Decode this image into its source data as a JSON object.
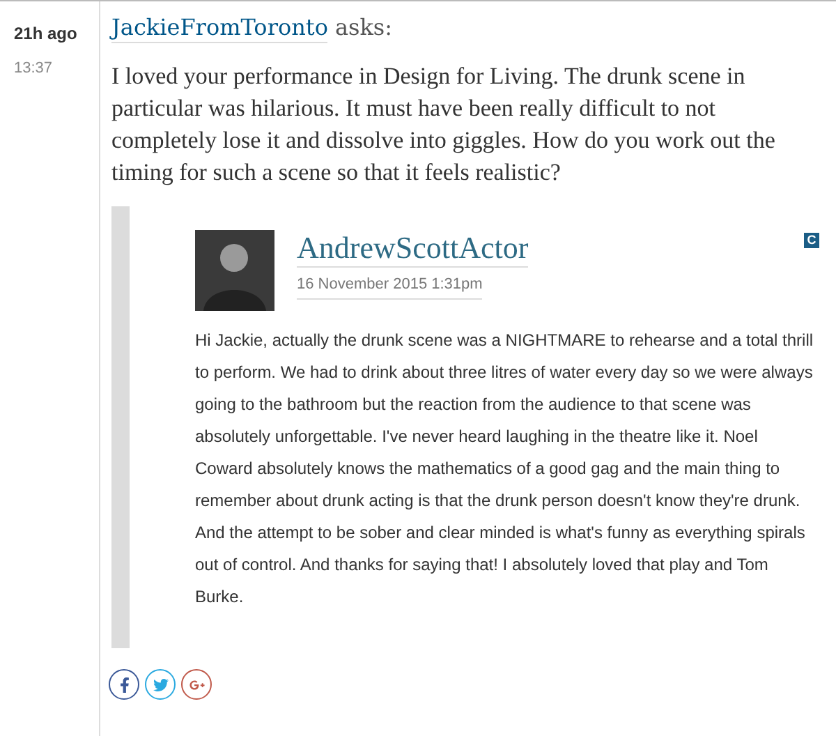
{
  "meta": {
    "age": "21h ago",
    "time": "13:37"
  },
  "question": {
    "author": "JackieFromToronto",
    "verb": "asks:",
    "text": "I loved your performance in Design for Living. The drunk scene in particular was hilarious. It must have been really difficult to not completely lose it and dissolve into giggles. How do you work out the timing for such a scene so that it feels realistic?"
  },
  "reply": {
    "author": "AndrewScottActor",
    "date": "16 November 2015 1:31pm",
    "badge": "C",
    "text": "Hi Jackie, actually the drunk scene was a NIGHTMARE to rehearse and a total thrill to perform. We had to drink about three litres of water every day so we were always going to the bathroom but the reaction from the audience to that scene was absolutely unforgettable. I've never heard laughing in the theatre like it. Noel Coward absolutely knows the mathematics of a good gag and the main thing to remember about drunk acting is that the drunk person doesn't know they're drunk. And the attempt to be sober and clear minded is what's funny as everything spirals out of control. And thanks for saying that! I absolutely loved that play and Tom Burke."
  },
  "share": [
    {
      "kind": "facebook"
    },
    {
      "kind": "twitter"
    },
    {
      "kind": "googleplus"
    }
  ]
}
